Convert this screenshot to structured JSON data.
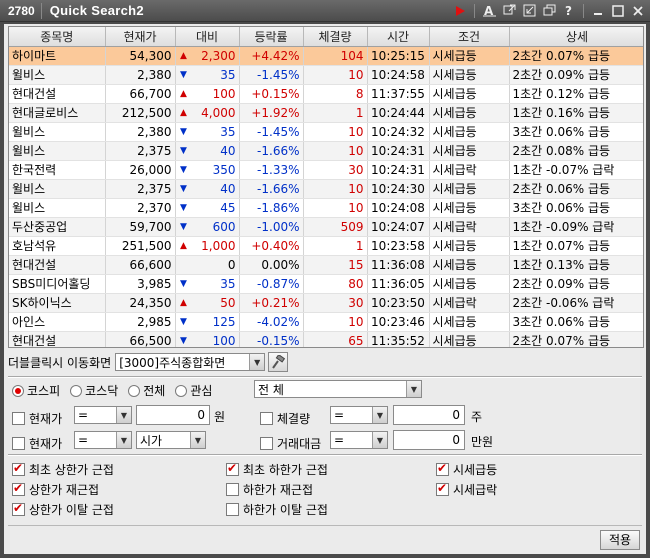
{
  "window": {
    "id": "2780",
    "title": "Quick Search2"
  },
  "columns": [
    "종목명",
    "현재가",
    "대비",
    "등락률",
    "체결량",
    "시간",
    "조건",
    "상세"
  ],
  "rows": [
    {
      "name": "하이마트",
      "price": "54,300",
      "dir": "up",
      "change": "2,300",
      "rate": "+4.42%",
      "vol": "104",
      "time": "10:25:15",
      "cond": "시세급등",
      "detail": "2초간 0.07% 급등",
      "selected": true
    },
    {
      "name": "윌비스",
      "price": "2,380",
      "dir": "dn",
      "change": "35",
      "rate": "-1.45%",
      "vol": "10",
      "time": "10:24:58",
      "cond": "시세급등",
      "detail": "2초간 0.09% 급등"
    },
    {
      "name": "현대건설",
      "price": "66,700",
      "dir": "up",
      "change": "100",
      "rate": "+0.15%",
      "vol": "8",
      "time": "11:37:55",
      "cond": "시세급등",
      "detail": "1초간 0.12% 급등"
    },
    {
      "name": "현대글로비스",
      "price": "212,500",
      "dir": "up",
      "change": "4,000",
      "rate": "+1.92%",
      "vol": "1",
      "time": "10:24:44",
      "cond": "시세급등",
      "detail": "1초간 0.16% 급등"
    },
    {
      "name": "윌비스",
      "price": "2,380",
      "dir": "dn",
      "change": "35",
      "rate": "-1.45%",
      "vol": "10",
      "time": "10:24:32",
      "cond": "시세급등",
      "detail": "3초간 0.06% 급등"
    },
    {
      "name": "윌비스",
      "price": "2,375",
      "dir": "dn",
      "change": "40",
      "rate": "-1.66%",
      "vol": "10",
      "time": "10:24:31",
      "cond": "시세급등",
      "detail": "2초간 0.08% 급등"
    },
    {
      "name": "한국전력",
      "price": "26,000",
      "dir": "dn",
      "change": "350",
      "rate": "-1.33%",
      "vol": "30",
      "time": "10:24:31",
      "cond": "시세급락",
      "detail": "1초간 -0.07% 급락"
    },
    {
      "name": "윌비스",
      "price": "2,375",
      "dir": "dn",
      "change": "40",
      "rate": "-1.66%",
      "vol": "10",
      "time": "10:24:30",
      "cond": "시세급등",
      "detail": "2초간 0.06% 급등"
    },
    {
      "name": "윌비스",
      "price": "2,370",
      "dir": "dn",
      "change": "45",
      "rate": "-1.86%",
      "vol": "10",
      "time": "10:24:08",
      "cond": "시세급등",
      "detail": "3초간 0.06% 급등"
    },
    {
      "name": "두산중공업",
      "price": "59,700",
      "dir": "dn",
      "change": "600",
      "rate": "-1.00%",
      "vol": "509",
      "time": "10:24:07",
      "cond": "시세급락",
      "detail": "1초간 -0.09% 급락"
    },
    {
      "name": "호남석유",
      "price": "251,500",
      "dir": "up",
      "change": "1,000",
      "rate": "+0.40%",
      "vol": "1",
      "time": "10:23:58",
      "cond": "시세급등",
      "detail": "1초간 0.07% 급등"
    },
    {
      "name": "현대건설",
      "price": "66,600",
      "dir": "none",
      "change": "0",
      "rate": "0.00%",
      "vol": "15",
      "time": "11:36:08",
      "cond": "시세급등",
      "detail": "1초간 0.13% 급등"
    },
    {
      "name": "SBS미디어홀딩",
      "price": "3,985",
      "dir": "dn",
      "change": "35",
      "rate": "-0.87%",
      "vol": "80",
      "time": "11:36:05",
      "cond": "시세급등",
      "detail": "2초간 0.09% 급등"
    },
    {
      "name": "SK하이닉스",
      "price": "24,350",
      "dir": "up",
      "change": "50",
      "rate": "+0.21%",
      "vol": "30",
      "time": "10:23:50",
      "cond": "시세급락",
      "detail": "2초간 -0.06% 급락"
    },
    {
      "name": "아인스",
      "price": "2,985",
      "dir": "dn",
      "change": "125",
      "rate": "-4.02%",
      "vol": "10",
      "time": "10:23:46",
      "cond": "시세급등",
      "detail": "3초간 0.06% 급등"
    },
    {
      "name": "현대건설",
      "price": "66,500",
      "dir": "dn",
      "change": "100",
      "rate": "-0.15%",
      "vol": "65",
      "time": "11:35:52",
      "cond": "시세급등",
      "detail": "2초간 0.07% 급등"
    }
  ],
  "nav": {
    "label": "더블클릭시 이동화면",
    "screen": "[3000]주식종합화면"
  },
  "market": {
    "options": [
      "코스피",
      "코스닥",
      "전체",
      "관심"
    ],
    "selected": 0,
    "scope": "전  체"
  },
  "filters": {
    "price1": {
      "label": "현재가",
      "op": "=",
      "value": "0",
      "unit": "원"
    },
    "volume": {
      "label": "체결량",
      "op": "=",
      "value": "0",
      "unit": "주"
    },
    "price2": {
      "label": "현재가",
      "op": "=",
      "ref": "시가"
    },
    "amount": {
      "label": "거래대금",
      "op": "=",
      "value": "0",
      "unit": "만원"
    }
  },
  "conditions": [
    {
      "label": "최초 상한가 근접",
      "checked": true
    },
    {
      "label": "최초 하한가 근접",
      "checked": true
    },
    {
      "label": "시세급등",
      "checked": true
    },
    {
      "label": "상한가 재근접",
      "checked": true
    },
    {
      "label": "하한가 재근접",
      "checked": false
    },
    {
      "label": "시세급락",
      "checked": true
    },
    {
      "label": "상한가 이탈 근접",
      "checked": true
    },
    {
      "label": "하한가 이탈 근접",
      "checked": false
    }
  ],
  "apply_label": "적용",
  "colors": {
    "up": "#d00000",
    "down": "#0030c8",
    "selected_row": "#fbc99a"
  }
}
